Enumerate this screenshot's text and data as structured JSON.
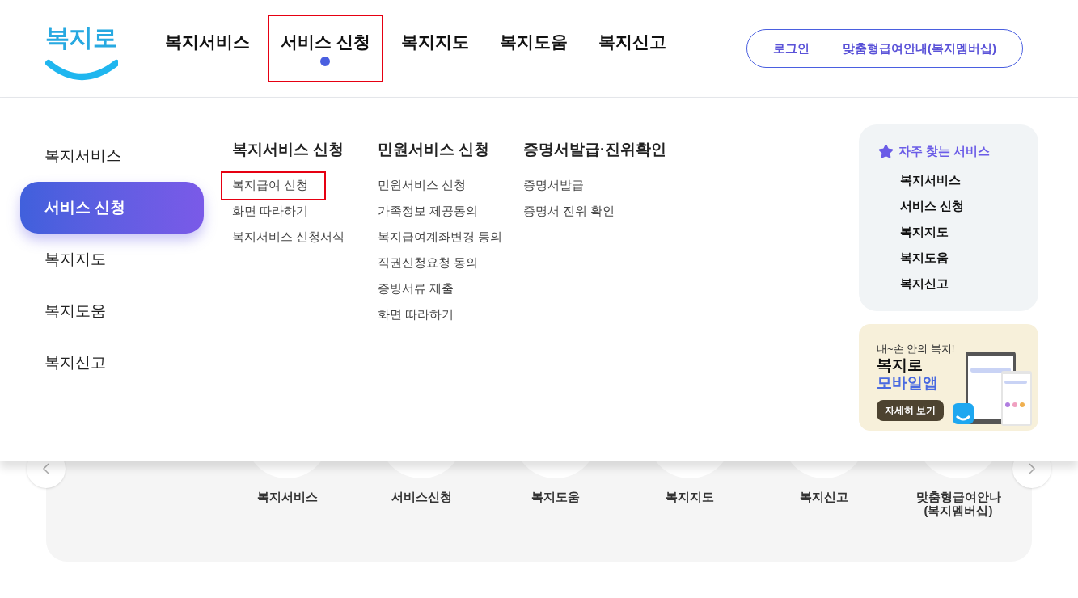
{
  "logo": "복지로",
  "nav": [
    {
      "label": "복지서비스",
      "selected": false,
      "highlighted": false
    },
    {
      "label": "서비스 신청",
      "selected": true,
      "highlighted": true
    },
    {
      "label": "복지지도",
      "selected": false,
      "highlighted": false
    },
    {
      "label": "복지도움",
      "selected": false,
      "highlighted": false
    },
    {
      "label": "복지신고",
      "selected": false,
      "highlighted": false
    }
  ],
  "account_links": [
    "로그인",
    "맞춤형급여안내(복지멤버십)"
  ],
  "mega_menu": {
    "side_items": [
      {
        "label": "복지서비스",
        "selected": false
      },
      {
        "label": "서비스 신청",
        "selected": true
      },
      {
        "label": "복지지도",
        "selected": false
      },
      {
        "label": "복지도움",
        "selected": false
      },
      {
        "label": "복지신고",
        "selected": false
      }
    ],
    "columns": [
      {
        "title": "복지서비스 신청",
        "links": [
          {
            "label": "복지급여 신청",
            "highlighted": true
          },
          {
            "label": "화면 따라하기",
            "highlighted": false
          },
          {
            "label": "복지서비스 신청서식",
            "highlighted": false
          }
        ]
      },
      {
        "title": "민원서비스 신청",
        "links": [
          {
            "label": "민원서비스 신청",
            "highlighted": false
          },
          {
            "label": "가족정보 제공동의",
            "highlighted": false
          },
          {
            "label": "복지급여계좌변경 동의",
            "highlighted": false
          },
          {
            "label": "직권신청요청 동의",
            "highlighted": false
          },
          {
            "label": "증빙서류 제출",
            "highlighted": false
          },
          {
            "label": "화면 따라하기",
            "highlighted": false
          }
        ]
      },
      {
        "title": "증명서발급·진위확인",
        "links": [
          {
            "label": "증명서발급",
            "highlighted": false
          },
          {
            "label": "증명서 진위 확인",
            "highlighted": false
          }
        ]
      }
    ],
    "favorites": {
      "title": "자주 찾는 서비스",
      "items": [
        "복지서비스",
        "서비스 신청",
        "복지지도",
        "복지도움",
        "복지신고"
      ]
    },
    "app_banner": {
      "tagline": "내~손 안의 복지!",
      "title": "복지로",
      "subtitle": "모바일앱",
      "button": "자세히 보기"
    }
  },
  "quick_menu": {
    "items": [
      {
        "label": "복지서비스"
      },
      {
        "label": "서비스신청"
      },
      {
        "label": "복지도움"
      },
      {
        "label": "복지지도"
      },
      {
        "label": "복지신고"
      },
      {
        "label": "맞춤형급여안나\n(복지멤버십)"
      }
    ]
  }
}
